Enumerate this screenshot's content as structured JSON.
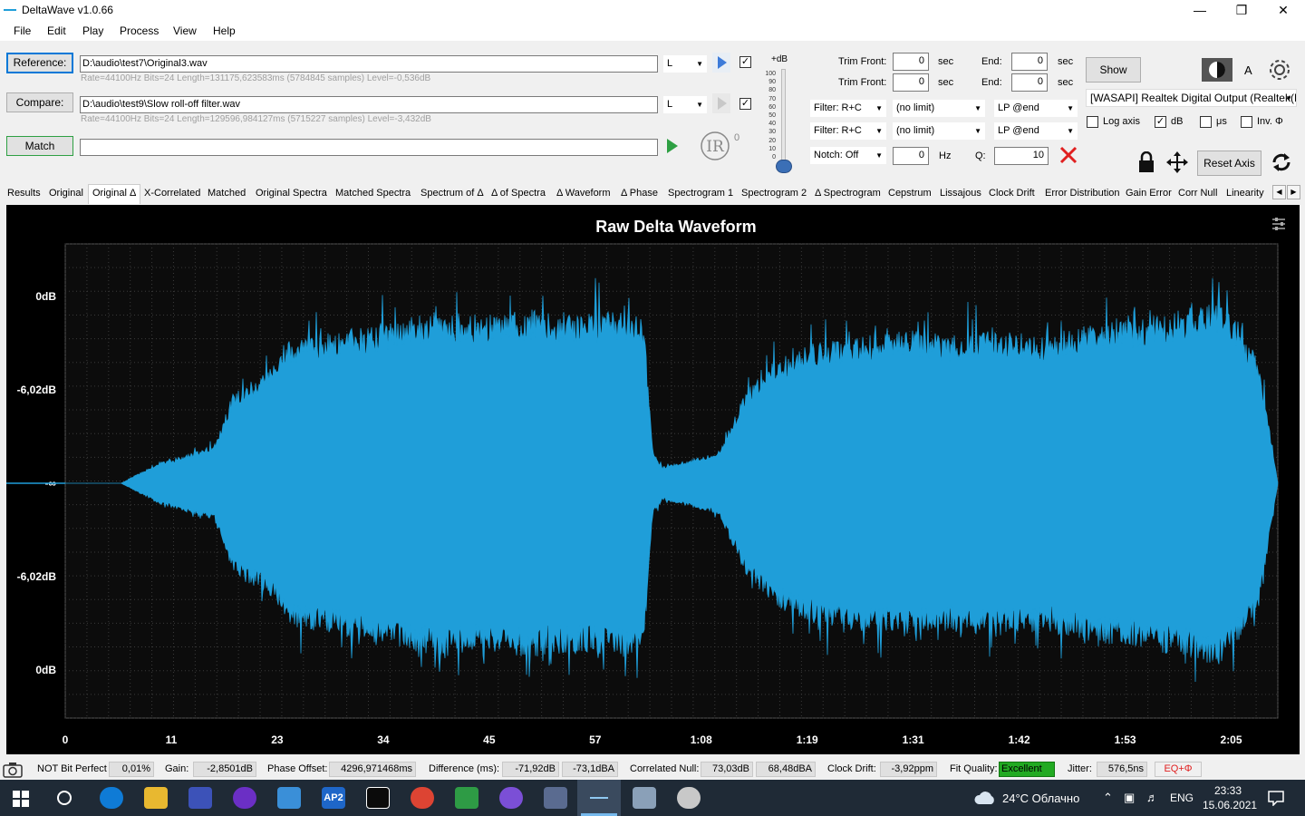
{
  "window": {
    "title": "DeltaWave v1.0.66"
  },
  "menu": [
    "File",
    "Edit",
    "Play",
    "Process",
    "View",
    "Help"
  ],
  "reference": {
    "button": "Reference:",
    "path": "D:\\audio\\test7\\Original3.wav",
    "info": "Rate=44100Hz Bits=24 Length=131175,623583ms (5784845 samples) Level=-0,536dB",
    "channel": "L"
  },
  "compare": {
    "button": "Compare:",
    "path": "D:\\audio\\test9\\Slow roll-off filter.wav",
    "info": "Rate=44100Hz Bits=24 Length=129596,984127ms (5715227 samples) Level=-3,432dB",
    "channel": "L"
  },
  "match": {
    "button": "Match"
  },
  "ir_label": "IR",
  "ir_sup": "0",
  "level_slider": {
    "label": "+dB",
    "ticks": [
      "100",
      "90",
      "80",
      "70",
      "60",
      "50",
      "40",
      "30",
      "20",
      "10",
      "0"
    ]
  },
  "trim": {
    "front_label": "Trim Front:",
    "end_label": "End:",
    "unit": "sec",
    "rows": [
      {
        "front": "0",
        "end": "0"
      },
      {
        "front": "0",
        "end": "0"
      }
    ]
  },
  "filters": [
    {
      "type": "Filter: R+C",
      "limit": "(no limit)",
      "lp": "LP @end"
    },
    {
      "type": "Filter: R+C",
      "limit": "(no limit)",
      "lp": "LP @end"
    }
  ],
  "notch": {
    "label": "Notch: Off",
    "hz_value": "0",
    "hz_unit": "Hz",
    "q_label": "Q:",
    "q_value": "10"
  },
  "show_button": "Show",
  "a_label": "A",
  "output_device": "[WASAPI] Realtek Digital Output (Realtek(R",
  "options": [
    {
      "label": "Log axis",
      "checked": false
    },
    {
      "label": "dB",
      "checked": true
    },
    {
      "label": "μs",
      "checked": false
    },
    {
      "label": "Inv. Φ",
      "checked": false
    }
  ],
  "reset_axis": "Reset Axis",
  "tabs": [
    "Results",
    "Original",
    "Original Δ",
    "X-Correlated",
    "Matched",
    "Original Spectra",
    "Matched Spectra",
    "Spectrum of Δ",
    "Δ of Spectra",
    "Δ Waveform",
    "Δ Phase",
    "Spectrogram 1",
    "Spectrogram 2",
    "Δ Spectrogram",
    "Cepstrum",
    "Lissajous",
    "Clock Drift",
    "Error Distribution",
    "Gain Error",
    "Corr Null",
    "Linearity"
  ],
  "active_tab": "Original Δ",
  "chart_data": {
    "type": "area",
    "title": "Raw Delta Waveform",
    "y_ticks": [
      "0dB",
      "-6,02dB",
      "-∞",
      "-6,02dB",
      "0dB"
    ],
    "x_ticks": [
      "0",
      "11",
      "23",
      "34",
      "45",
      "57",
      "1:08",
      "1:19",
      "1:31",
      "1:42",
      "1:53",
      "2:05"
    ],
    "xlim": [
      0,
      130
    ],
    "series_color": "#1f9ed9",
    "grid": true,
    "envelope": {
      "x": [
        0,
        6,
        10,
        16,
        18,
        22,
        24,
        30,
        36,
        40,
        45,
        50,
        55,
        60,
        62,
        63,
        64,
        70,
        73,
        76,
        80,
        85,
        90,
        95,
        100,
        105,
        110,
        115,
        120,
        124,
        128,
        130
      ],
      "level": [
        0,
        0,
        0.1,
        0.18,
        0.45,
        0.55,
        0.7,
        0.75,
        0.8,
        0.85,
        0.82,
        0.85,
        0.82,
        0.85,
        0.8,
        0.15,
        0.08,
        0.15,
        0.45,
        0.6,
        0.68,
        0.72,
        0.75,
        0.72,
        0.75,
        0.72,
        0.78,
        0.8,
        0.85,
        0.9,
        0.6,
        0
      ]
    }
  },
  "status": {
    "bitperfect": "NOT Bit Perfect",
    "bitperfect_pct": "0,01%",
    "gain_label": "Gain:",
    "gain": "-2,8501dB",
    "phase_label": "Phase Offset:",
    "phase": "4296,971468ms",
    "diff_label": "Difference (ms):",
    "diff_db": "-71,92dB",
    "diff_dba": "-73,1dBA",
    "null_label": "Correlated Null:",
    "null_db": "73,03dB",
    "null_dba": "68,48dBA",
    "drift_label": "Clock Drift:",
    "drift": "-3,92ppm",
    "fit_label": "Fit Quality:",
    "fit": "Excellent",
    "jitter_label": "Jitter:",
    "jitter": "576,5ns",
    "eq": "EQ+Φ"
  },
  "taskbar": {
    "weather": "24°C  Облачно",
    "lang": "ENG",
    "time": "23:33",
    "date": "15.06.2021",
    "ap2": "AP2"
  }
}
